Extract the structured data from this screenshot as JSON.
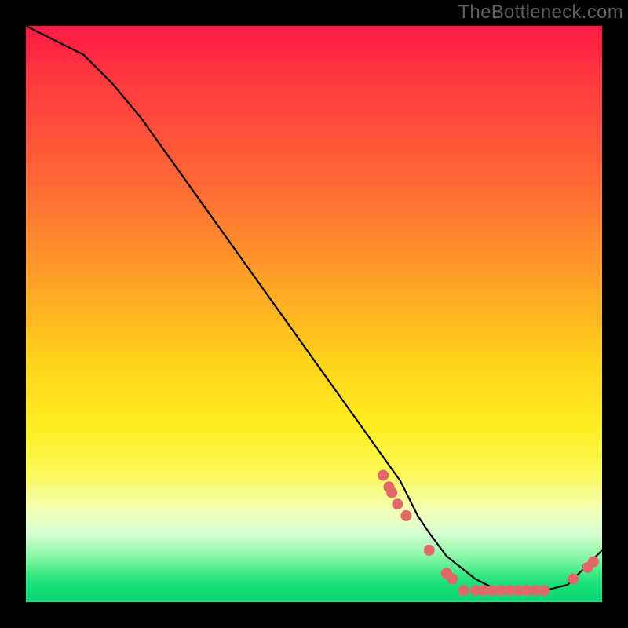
{
  "watermark": "TheBottleneck.com",
  "chart_data": {
    "type": "line",
    "title": "",
    "xlabel": "",
    "ylabel": "",
    "xlim": [
      0,
      100
    ],
    "ylim": [
      0,
      100
    ],
    "grid": false,
    "legend": false,
    "series": [
      {
        "name": "curve",
        "x": [
          0,
          6,
          10,
          15,
          20,
          25,
          30,
          35,
          40,
          45,
          50,
          55,
          60,
          65,
          68,
          70,
          73,
          78,
          82,
          86,
          90,
          94,
          97,
          100
        ],
        "y": [
          100,
          97,
          95,
          90,
          84,
          77,
          70,
          63,
          56,
          49,
          42,
          35,
          28,
          21,
          15,
          12,
          8,
          4,
          2,
          2,
          2,
          3,
          6,
          9
        ]
      }
    ],
    "markers": [
      {
        "x": 62,
        "y": 22
      },
      {
        "x": 63,
        "y": 20
      },
      {
        "x": 63.5,
        "y": 19
      },
      {
        "x": 64.5,
        "y": 17
      },
      {
        "x": 66,
        "y": 15
      },
      {
        "x": 70,
        "y": 9
      },
      {
        "x": 73,
        "y": 5
      },
      {
        "x": 74,
        "y": 4
      },
      {
        "x": 76,
        "y": 2
      },
      {
        "x": 78,
        "y": 2
      },
      {
        "x": 79.5,
        "y": 2
      },
      {
        "x": 81,
        "y": 2
      },
      {
        "x": 82.5,
        "y": 2
      },
      {
        "x": 84,
        "y": 2
      },
      {
        "x": 85.5,
        "y": 2
      },
      {
        "x": 87,
        "y": 2
      },
      {
        "x": 88.5,
        "y": 2
      },
      {
        "x": 90,
        "y": 2
      },
      {
        "x": 95,
        "y": 4
      },
      {
        "x": 97.5,
        "y": 6
      },
      {
        "x": 98.5,
        "y": 7
      }
    ],
    "marker_color": "#e06868",
    "line_color": "#000000"
  }
}
